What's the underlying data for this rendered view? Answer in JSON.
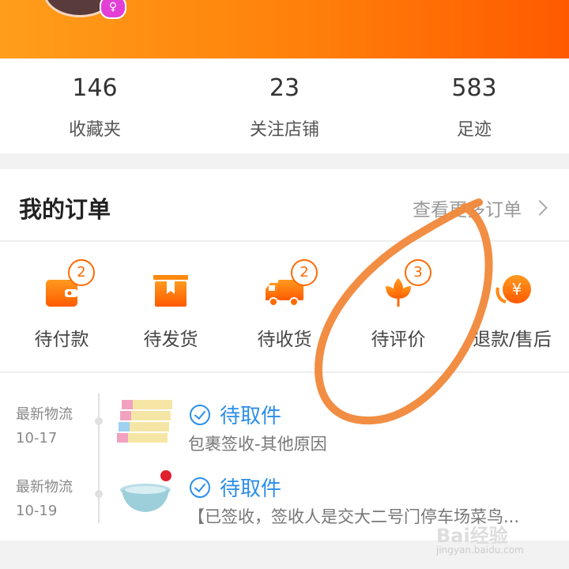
{
  "profile": {
    "gender_symbol": "♀"
  },
  "stats": [
    {
      "count": "146",
      "label": "收藏夹"
    },
    {
      "count": "23",
      "label": "关注店铺"
    },
    {
      "count": "583",
      "label": "足迹"
    }
  ],
  "orders": {
    "title": "我的订单",
    "view_all": "查看更多订单",
    "statuses": [
      {
        "label": "待付款",
        "badge": "2",
        "icon": "wallet-icon"
      },
      {
        "label": "待发货",
        "badge": "",
        "icon": "package-icon"
      },
      {
        "label": "待收货",
        "badge": "2",
        "icon": "truck-icon"
      },
      {
        "label": "待评价",
        "badge": "3",
        "icon": "flower-icon"
      },
      {
        "label": "退款/售后",
        "badge": "",
        "icon": "refund-icon"
      }
    ]
  },
  "logistics": [
    {
      "label": "最新物流",
      "date": "10-17",
      "status": "待取件",
      "detail": "包裹签收-其他原因"
    },
    {
      "label": "最新物流",
      "date": "10-19",
      "status": "待取件",
      "detail": "【已签收，签收人是交大二号门停车场菜鸟..."
    }
  ],
  "watermark": {
    "brand": "Bai经验",
    "url": "jingyan.baidu.com"
  },
  "colors": {
    "accent": "#ff6a00",
    "link_blue": "#2c8ee8",
    "annotation": "#f0883a"
  }
}
